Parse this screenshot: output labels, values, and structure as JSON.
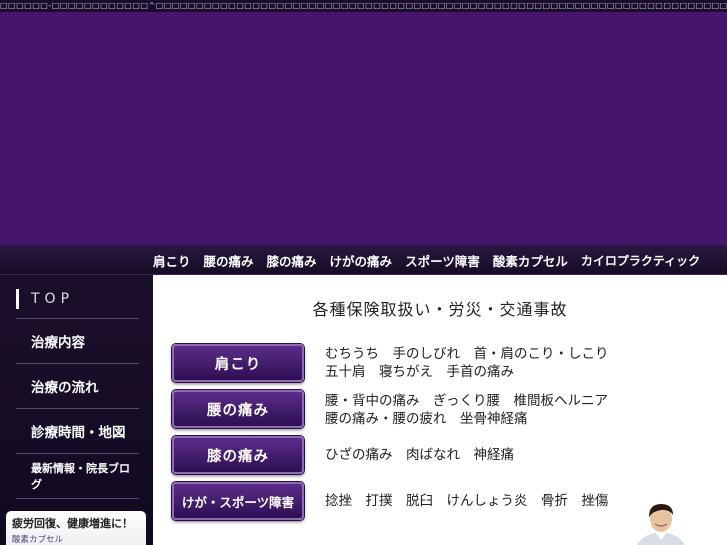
{
  "top_strip": {
    "text": "□□□□□□-□□□□□□□□□□□□^□□□□□□□□□□□□□□□□□□□□□□□□□□□□□□□□□□□□□□□□□□□□□□□□□□□□□□□□□□□□□□□□□□□□□□□□□□□□□□□□□□□"
  },
  "top_nav": {
    "items": [
      {
        "label": "肩こり"
      },
      {
        "label": "腰の痛み"
      },
      {
        "label": "膝の痛み"
      },
      {
        "label": "けがの痛み"
      },
      {
        "label": "スポーツ障害"
      },
      {
        "label": "酸素カプセル"
      },
      {
        "label": "カイロプラクティック"
      }
    ]
  },
  "sidebar": {
    "items": [
      {
        "label": "TOP"
      },
      {
        "label": "治療内容"
      },
      {
        "label": "治療の流れ"
      },
      {
        "label": "診療時間・地図"
      },
      {
        "label": "最新情報・院長ブログ"
      }
    ],
    "ad": {
      "title": "疲労回復、健康増進に！",
      "subtitle": "酸素カプセル"
    }
  },
  "main": {
    "heading": "各種保険取扱い・労災・交通事故",
    "services": [
      {
        "button": "肩こり",
        "lines": [
          "むちうち　手のしびれ　首・肩のこり・しこり",
          "五十肩　寝ちがえ　手首の痛み"
        ]
      },
      {
        "button": "腰の痛み",
        "lines": [
          "腰・背中の痛み　ぎっくり腰　椎間板ヘルニア",
          "腰の痛み・腰の疲れ　坐骨神経痛"
        ]
      },
      {
        "button": "膝の痛み",
        "lines": [
          "ひざの痛み　肉ばなれ　神経痛"
        ]
      },
      {
        "button": "けが・スポーツ障害",
        "lines": [
          "捻挫　打撲　脱臼　けんしょう炎　骨折　挫傷"
        ]
      }
    ]
  },
  "colors": {
    "banner": "#46166f",
    "nav_bg": "#1e0f33",
    "button_top": "#5b2d8a",
    "button_bottom": "#2e0f52",
    "button_border": "#8f6bb7"
  }
}
